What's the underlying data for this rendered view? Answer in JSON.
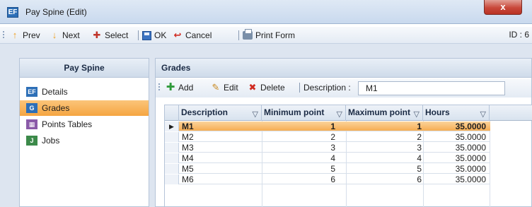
{
  "window": {
    "title": "Pay Spine (Edit)",
    "close_label": "x",
    "app_icon_label": "EF"
  },
  "toolbar": {
    "prev": "Prev",
    "next": "Next",
    "select": "Select",
    "ok": "OK",
    "cancel": "Cancel",
    "print_form": "Print Form",
    "id_label": "ID : 6"
  },
  "nav": {
    "header": "Pay Spine",
    "items": [
      {
        "label": "Details",
        "icon": "details-icon",
        "active": false
      },
      {
        "label": "Grades",
        "icon": "grades-icon",
        "active": true
      },
      {
        "label": "Points Tables",
        "icon": "points-tables-icon",
        "active": false
      },
      {
        "label": "Jobs",
        "icon": "jobs-icon",
        "active": false
      }
    ]
  },
  "grades": {
    "header": "Grades",
    "toolbar": {
      "add": "Add",
      "edit": "Edit",
      "delete": "Delete",
      "description_label": "Description :",
      "description_value": "M1"
    },
    "columns": [
      "Description",
      "Minimum point",
      "Maximum point",
      "Hours"
    ],
    "rows": [
      {
        "description": "M1",
        "min": "1",
        "max": "1",
        "hours": "35.0000",
        "selected": true
      },
      {
        "description": "M2",
        "min": "2",
        "max": "2",
        "hours": "35.0000",
        "selected": false
      },
      {
        "description": "M3",
        "min": "3",
        "max": "3",
        "hours": "35.0000",
        "selected": false
      },
      {
        "description": "M4",
        "min": "4",
        "max": "4",
        "hours": "35.0000",
        "selected": false
      },
      {
        "description": "M5",
        "min": "5",
        "max": "5",
        "hours": "35.0000",
        "selected": false
      },
      {
        "description": "M6",
        "min": "6",
        "max": "6",
        "hours": "35.0000",
        "selected": false
      }
    ]
  }
}
